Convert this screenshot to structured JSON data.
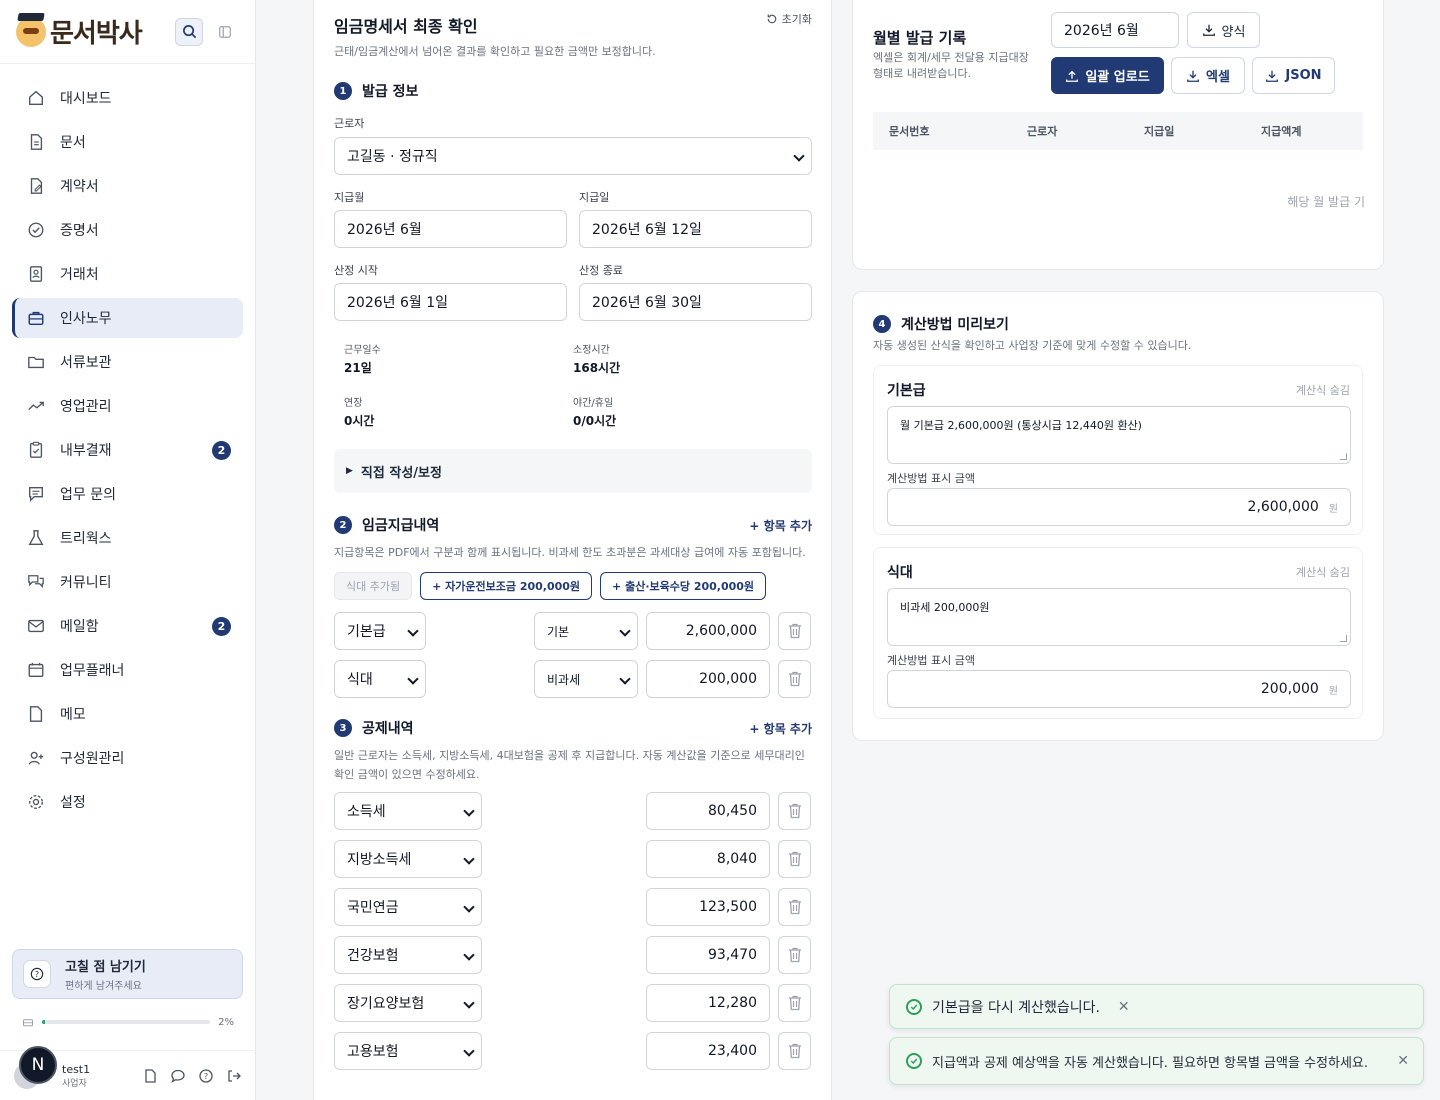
{
  "app": {
    "name": "문서박사"
  },
  "sidebar": {
    "items": [
      {
        "label": "대시보드",
        "icon": "home-icon"
      },
      {
        "label": "문서",
        "icon": "document-icon"
      },
      {
        "label": "계약서",
        "icon": "contract-icon"
      },
      {
        "label": "증명서",
        "icon": "certificate-icon"
      },
      {
        "label": "거래처",
        "icon": "contact-icon"
      },
      {
        "label": "인사노무",
        "icon": "briefcase-icon",
        "active": true
      },
      {
        "label": "서류보관",
        "icon": "folder-icon"
      },
      {
        "label": "영업관리",
        "icon": "trend-icon"
      },
      {
        "label": "내부결재",
        "icon": "clipboard-icon",
        "badge": "2"
      },
      {
        "label": "업무 문의",
        "icon": "message-icon"
      },
      {
        "label": "트리웍스",
        "icon": "flask-icon"
      },
      {
        "label": "커뮤니티",
        "icon": "chat-icon"
      },
      {
        "label": "메일함",
        "icon": "mail-icon",
        "badge": "2"
      },
      {
        "label": "업무플래너",
        "icon": "calendar-icon"
      },
      {
        "label": "메모",
        "icon": "memo-icon"
      },
      {
        "label": "구성원관리",
        "icon": "user-add-icon"
      },
      {
        "label": "설정",
        "icon": "gear-icon"
      }
    ],
    "feedback": {
      "title": "고칠 점 남기기",
      "subtitle": "편하게 남겨주세요"
    },
    "storage": {
      "percent_label": "2%",
      "percent": 2
    },
    "user": {
      "name": "test1",
      "role": "사업자",
      "initial": "N"
    }
  },
  "payslip": {
    "title": "임금명세서 최종 확인",
    "subtitle": "근태/임금계산에서 넘어온 결과를 확인하고 필요한 금액만 보정합니다.",
    "reset_label": "초기화",
    "issue": {
      "heading": "발급 정보",
      "worker_label": "근로자",
      "worker_value": "고길동 · 정규직",
      "pay_month_label": "지급월",
      "pay_month_value": "2026년 6월",
      "pay_date_label": "지급일",
      "pay_date_value": "2026년 6월 12일",
      "calc_start_label": "산정 시작",
      "calc_start_value": "2026년 6월 1일",
      "calc_end_label": "산정 종료",
      "calc_end_value": "2026년 6월 30일",
      "work_days_label": "근무일수",
      "work_days_value": "21일",
      "scheduled_hours_label": "소정시간",
      "scheduled_hours_value": "168시간",
      "overtime_label": "연장",
      "overtime_value": "0시간",
      "night_holiday_label": "야간/휴일",
      "night_holiday_value": "0/0시간",
      "manual_label": "직접 작성/보정"
    },
    "pay": {
      "heading": "임금지급내역",
      "add_label": "+ 항목 추가",
      "description": "지급항목은 PDF에서 구분과 함께 표시됩니다. 비과세 한도 초과분은 과세대상 급여에 자동 포함됩니다.",
      "chip_meal": "식대 추가됨",
      "chip_car": "+ 자가운전보조금 200,000원",
      "chip_child": "+ 출산·보육수당 200,000원",
      "rows": [
        {
          "item": "기본급",
          "type": "기본",
          "amount": "2,600,000"
        },
        {
          "item": "식대",
          "type": "비과세",
          "amount": "200,000"
        }
      ]
    },
    "deduction": {
      "heading": "공제내역",
      "add_label": "+ 항목 추가",
      "description": "일반 근로자는 소득세, 지방소득세, 4대보험을 공제 후 지급합니다. 자동 계산값을 기준으로 세무대리인 확인 금액이 있으면 수정하세요.",
      "rows": [
        {
          "item": "소득세",
          "amount": "80,450"
        },
        {
          "item": "지방소득세",
          "amount": "8,040"
        },
        {
          "item": "국민연금",
          "amount": "123,500"
        },
        {
          "item": "건강보험",
          "amount": "93,470"
        },
        {
          "item": "장기요양보험",
          "amount": "12,280"
        },
        {
          "item": "고용보험",
          "amount": "23,400"
        }
      ]
    }
  },
  "monthly": {
    "title": "월별 발급 기록",
    "subtitle": "엑셀은 회계/세무 전달용 지급대장 형태로 내려받습니다.",
    "month_value": "2026년 6월",
    "template_label": "양식",
    "bulk_upload_label": "일괄 업로드",
    "excel_label": "엑셀",
    "json_label": "JSON",
    "columns": [
      "문서번호",
      "근로자",
      "지급일",
      "지급액계"
    ],
    "empty_text": "해당 월 발급 기"
  },
  "preview": {
    "heading": "계산방법 미리보기",
    "subtitle": "자동 생성된 산식을 확인하고 사업장 기준에 맞게 수정할 수 있습니다.",
    "hide_label": "계산식 숨김",
    "amount_label": "계산방법 표시 금액",
    "won": "원",
    "cards": [
      {
        "title": "기본급",
        "formula": "월 기본급 2,600,000원 (통상시급 12,440원 환산)",
        "amount": "2,600,000"
      },
      {
        "title": "식대",
        "formula": "비과세 200,000원",
        "amount": "200,000"
      }
    ]
  },
  "toasts": [
    "기본급을 다시 계산했습니다.",
    "지급액과 공제 예상액을 자동 계산했습니다. 필요하면 항목별 금액을 수정하세요."
  ]
}
